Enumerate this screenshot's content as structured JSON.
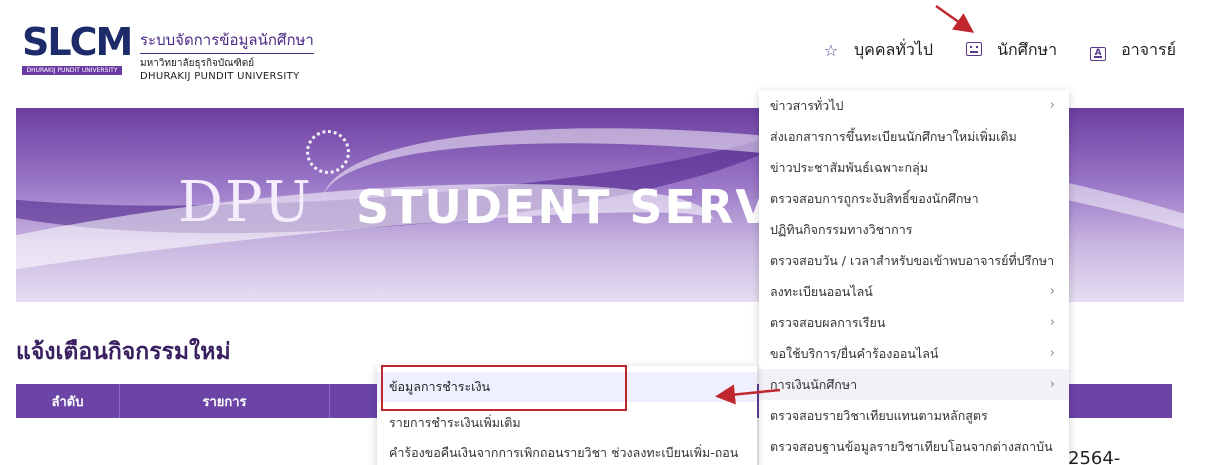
{
  "brand": {
    "logo": "SLCM",
    "logo_sub": "DHURAKIJ PUNDIT UNIVERSITY",
    "title_th": "ระบบจัดการข้อมูลนักศึกษา",
    "uni_th": "มหาวิทยาลัยธุรกิจบัณฑิตย์",
    "uni_en": "DHURAKIJ PUNDIT UNIVERSITY"
  },
  "nav": {
    "items": [
      {
        "label": "บุคคลทั่วไป",
        "icon": "star-icon"
      },
      {
        "label": "นักศึกษา",
        "icon": "student-icon"
      },
      {
        "label": "อาจารย์",
        "icon": "teacher-icon"
      }
    ]
  },
  "banner": {
    "dpu": "DPU",
    "service": "STUDENT SERVI"
  },
  "section": {
    "title": "แจ้งเตือนกิจกรรมใหม่",
    "col_no": "ลำดับ",
    "col_item": "รายการ",
    "partial_text": "2564-"
  },
  "menu": {
    "items": [
      {
        "label": "ข่าวสารทั่วไป",
        "has_sub": true
      },
      {
        "label": "ส่งเอกสารการขึ้นทะเบียนนักศึกษาใหม่เพิ่มเติม",
        "has_sub": false
      },
      {
        "label": "ข่าวประชาสัมพันธ์เฉพาะกลุ่ม",
        "has_sub": false
      },
      {
        "label": "ตรวจสอบการถูกระงับสิทธิ์ของนักศึกษา",
        "has_sub": false
      },
      {
        "label": "ปฏิทินกิจกรรมทางวิชาการ",
        "has_sub": false
      },
      {
        "label": "ตรวจสอบวัน / เวลาสำหรับขอเข้าพบอาจารย์ที่ปรึกษา",
        "has_sub": false
      },
      {
        "label": "ลงทะเบียนออนไลน์",
        "has_sub": true
      },
      {
        "label": "ตรวจสอบผลการเรียน",
        "has_sub": true
      },
      {
        "label": "ขอใช้บริการ/ยื่นคำร้องออนไลน์",
        "has_sub": true
      },
      {
        "label": "การเงินนักศึกษา",
        "has_sub": true
      },
      {
        "label": "ตรวจสอบรายวิชาเทียบแทนตามหลักสูตร",
        "has_sub": false
      },
      {
        "label": "ตรวจสอบฐานข้อมูลรายวิชาเทียบโอนจากต่างสถาบัน",
        "has_sub": false
      }
    ]
  },
  "submenu": {
    "items": [
      {
        "label": "ข้อมูลการชำระเงิน"
      },
      {
        "label": "รายการชำระเงินเพิ่มเติม"
      },
      {
        "label": "คำร้องขอคืนเงินจากการเพิกถอนรายวิชา ช่วงลงทะเบียนเพิ่ม-ถอน"
      }
    ]
  },
  "colors": {
    "accent": "#6b44a6",
    "highlight_box": "#c0272d"
  }
}
